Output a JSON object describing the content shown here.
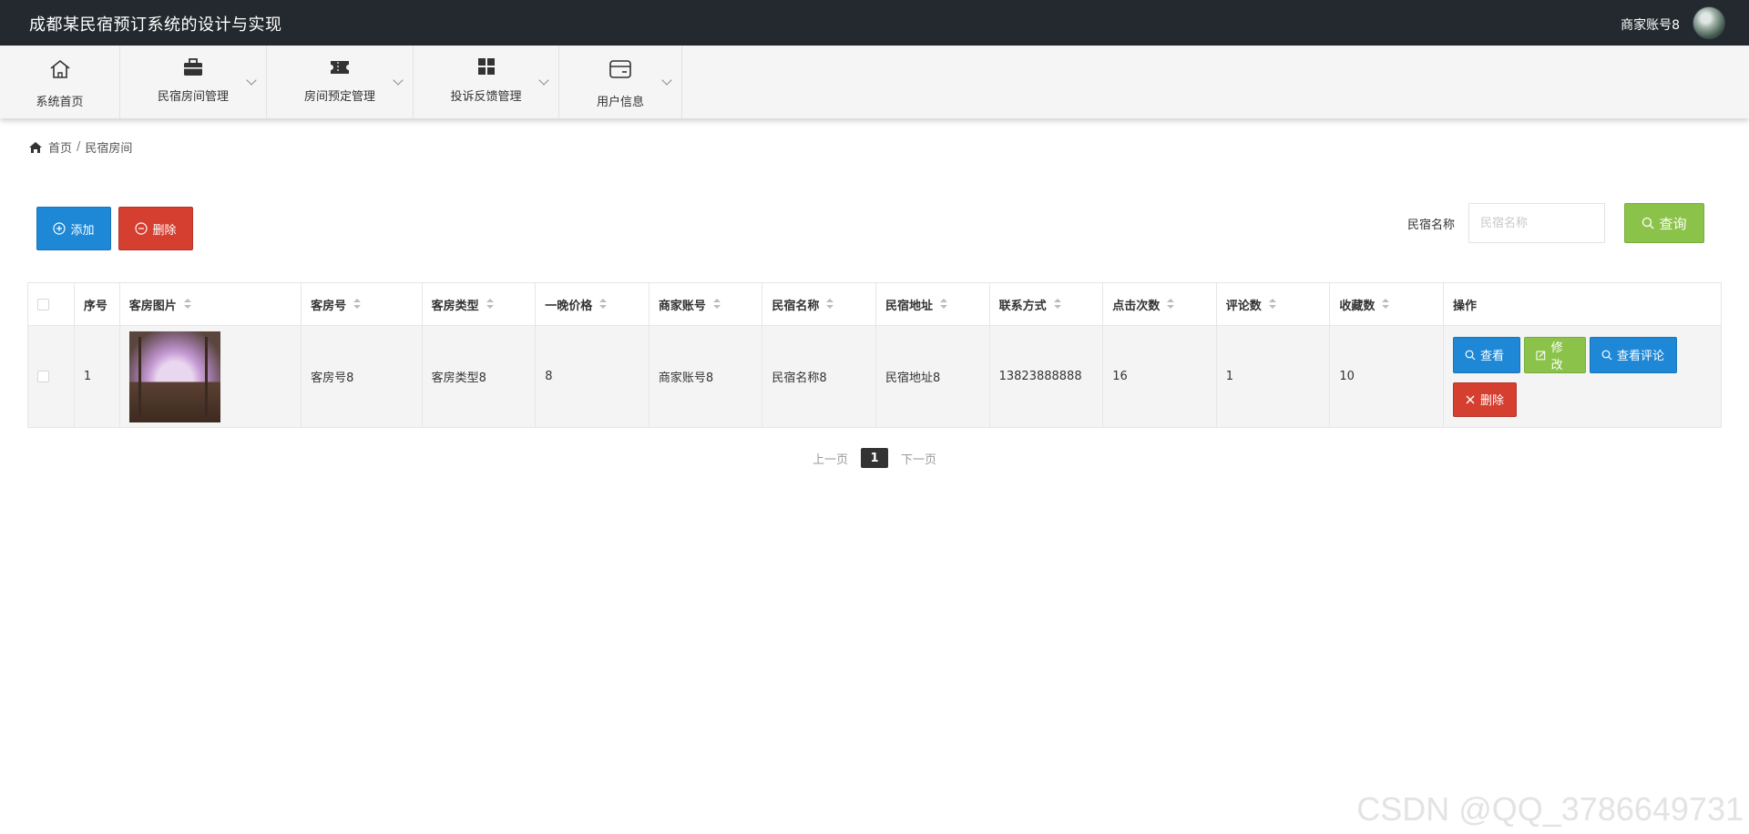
{
  "app": {
    "title": "成都某民宿预订系统的设计与实现",
    "user": "商家账号8"
  },
  "menu": [
    {
      "label": "系统首页",
      "icon": "home-icon"
    },
    {
      "label": "民宿房间管理",
      "icon": "briefcase-icon"
    },
    {
      "label": "房间预定管理",
      "icon": "ticket-icon"
    },
    {
      "label": "投诉反馈管理",
      "icon": "grid-icon"
    },
    {
      "label": "用户信息",
      "icon": "wallet-icon"
    }
  ],
  "breadcrumb": {
    "home": "首页",
    "sep": "/",
    "current": "民宿房间"
  },
  "toolbar": {
    "add_label": "添加",
    "delete_label": "删除"
  },
  "search": {
    "label": "民宿名称",
    "placeholder": "民宿名称",
    "button_label": "查询"
  },
  "table": {
    "columns": [
      "序号",
      "客房图片",
      "客房号",
      "客房类型",
      "一晚价格",
      "商家账号",
      "民宿名称",
      "民宿地址",
      "联系方式",
      "点击次数",
      "评论数",
      "收藏数",
      "操作"
    ],
    "rows": [
      {
        "index": "1",
        "room_no": "客房号8",
        "room_type": "客房类型8",
        "price": "8",
        "merchant": "商家账号8",
        "homestay_name": "民宿名称8",
        "address": "民宿地址8",
        "phone": "13823888888",
        "clicks": "16",
        "comments": "1",
        "favorites": "10",
        "actions": {
          "view": "查看",
          "edit": "修改",
          "comments": "查看评论",
          "delete": "删除"
        }
      }
    ]
  },
  "pagination": {
    "prev": "上一页",
    "current": "1",
    "next": "下一页"
  },
  "watermark": "CSDN @QQ_3786649731",
  "colors": {
    "primary": "#1e88d6",
    "success": "#8bc34a",
    "danger": "#d43f30",
    "topbar": "#23292e"
  }
}
